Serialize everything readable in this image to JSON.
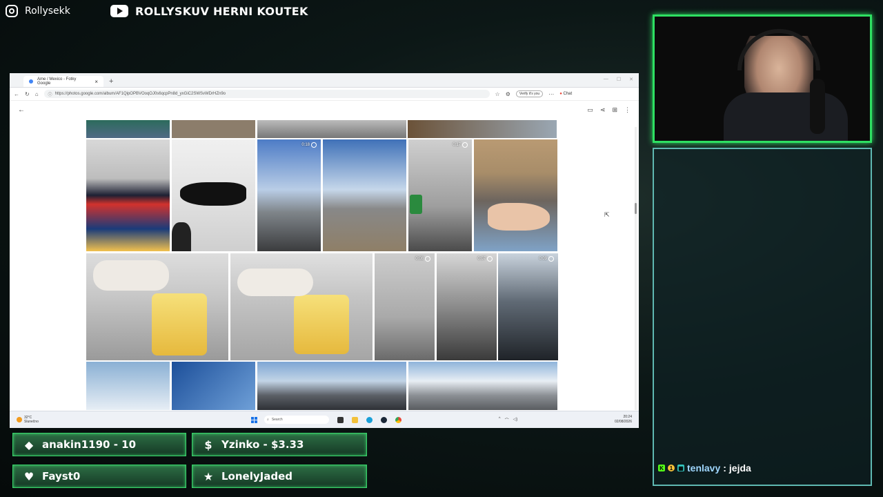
{
  "overlay": {
    "instagram": {
      "label": "Rollysekk",
      "icon": "instagram-icon"
    },
    "youtube": {
      "label": "ROLLYSKUV HERNI KOUTEK",
      "icon": "youtube-icon"
    },
    "alerts": [
      {
        "icon": "diamond-icon",
        "text": "anakin1190 - 10"
      },
      {
        "icon": "dollar-icon",
        "text": "Yzinko - $3.33"
      },
      {
        "icon": "heart-icon",
        "text": "Fayst0"
      },
      {
        "icon": "star-icon",
        "text": "LonelyJaded"
      }
    ],
    "chat": {
      "user": "tenlavy",
      "separator": ":",
      "message": "jejda",
      "badge_text": "1"
    }
  },
  "browser": {
    "tab_title": "Ame / Mexico - Fotky Google",
    "new_tab": "+",
    "url": "https://photos.google.com/album/AF1QipOPBVOoqOJ0s6qcpPn8d_yxGiC2SWSvWDrHZn9o",
    "verify_label": "Verify it's you",
    "chat_label": "Chat"
  },
  "photos": {
    "durations": [
      "0:18",
      "0:17",
      "0:08",
      "0:07",
      "0:09"
    ]
  },
  "taskbar": {
    "weather_temp": "32°C",
    "weather_desc": "Slunečno",
    "search_label": "Search",
    "time": "20:24",
    "date": "02/08/2026"
  },
  "colors": {
    "overlay_green": "#39d36a",
    "chat_border": "#5fb9b2",
    "accent_blue": "#1a73e8"
  }
}
